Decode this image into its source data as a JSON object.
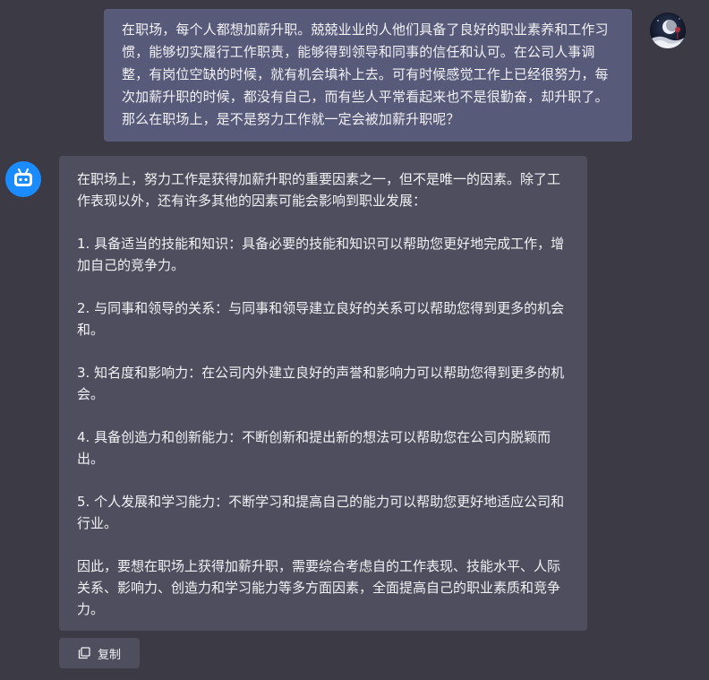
{
  "conversation": {
    "user_message": {
      "avatar_icon": "user-avatar-moon-night",
      "text": "在职场，每个人都想加薪升职。兢兢业业的人他们具备了良好的职业素养和工作习惯，能够切实履行工作职责，能够得到领导和同事的信任和认可。在公司人事调整，有岗位空缺的时候，就有机会填补上去。可有时候感觉工作上已经很努力，每次加薪升职的时候，都没有自己，而有些人平常看起来也不是很勤奋，却升职了。那么在职场上，是不是努力工作就一定会被加薪升职呢？"
    },
    "bot_message": {
      "avatar_icon": "robot-avatar-icon",
      "paragraphs": [
        "在职场上，努力工作是获得加薪升职的重要因素之一，但不是唯一的因素。除了工作表现以外，还有许多其他的因素可能会影响到职业发展：",
        "1. 具备适当的技能和知识：具备必要的技能和知识可以帮助您更好地完成工作，增加自己的竞争力。",
        "2. 与同事和领导的关系：与同事和领导建立良好的关系可以帮助您得到更多的机会和。",
        "3. 知名度和影响力：在公司内外建立良好的声誉和影响力可以帮助您得到更多的机会。",
        "4. 具备创造力和创新能力：不断创新和提出新的想法可以帮助您在公司内脱颖而出。",
        "5. 个人发展和学习能力：不断学习和提高自己的能力可以帮助您更好地适应公司和行业。",
        "因此，要想在职场上获得加薪升职，需要综合考虑自的工作表现、技能水平、人际关系、影响力、创造力和学习能力等多方面因素，全面提高自己的职业素质和竞争力。"
      ]
    },
    "copy_button": {
      "label": "复制",
      "icon": "copy-icon"
    }
  },
  "colors": {
    "background": "#3b3a45",
    "user_bubble": "#585a79",
    "bot_bubble": "#4e4e5e",
    "bot_avatar": "#1a8cff",
    "text": "#f1f1f5"
  }
}
